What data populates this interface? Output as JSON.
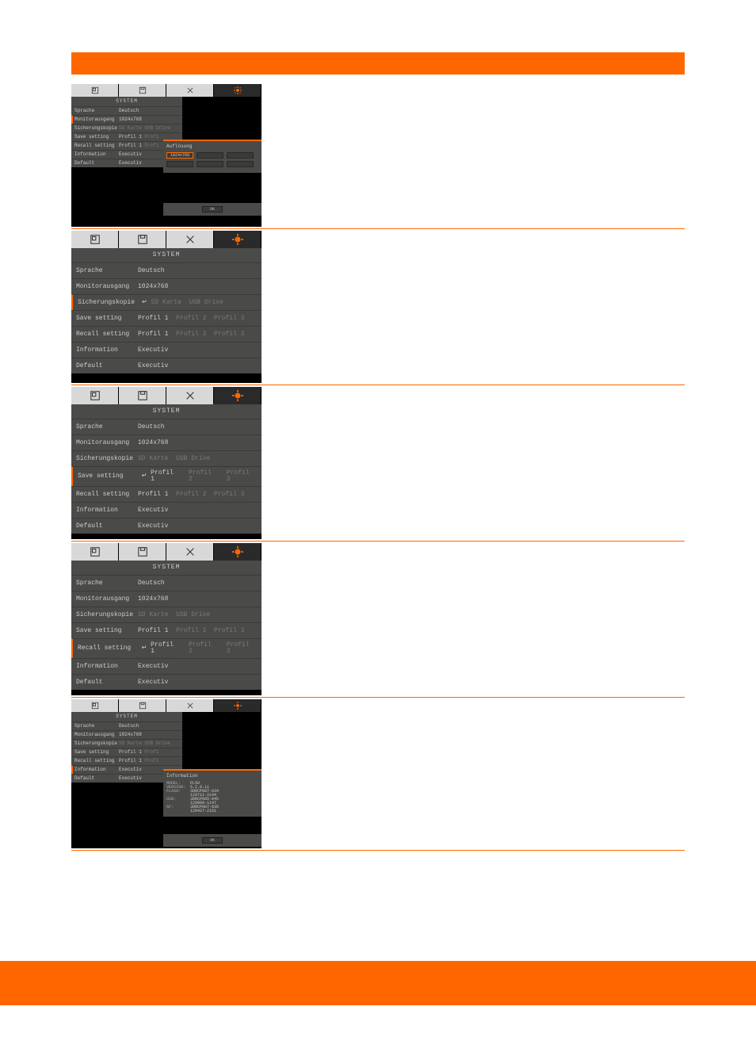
{
  "system_title": "SYSTEM",
  "menu": {
    "sprache": {
      "label": "Sprache",
      "value": "Deutsch"
    },
    "monitor": {
      "label": "Monitorausgang",
      "value": "1024x768"
    },
    "sicher": {
      "label": "Sicherungskopie",
      "sd": "SD Karte",
      "usb": "USB Drive"
    },
    "save": {
      "label": "Save setting",
      "p1": "Profil 1",
      "p2": "Profil 2",
      "p3": "Profil 3"
    },
    "recall": {
      "label": "Recall setting",
      "p1": "Profil 1",
      "p2": "Profil 2",
      "p3": "Profil 3"
    },
    "info": {
      "label": "Information",
      "value": "Executiv"
    },
    "default": {
      "label": "Default",
      "value": "Executiv"
    }
  },
  "popup_res": {
    "title": "Auflösung",
    "opts": [
      "1024x768",
      "",
      "",
      "",
      "",
      ""
    ],
    "ok": "OK"
  },
  "popup_info": {
    "title": "Information",
    "rows": [
      {
        "k": "MODEL:",
        "v": "PL50"
      },
      {
        "k": "VERSION:",
        "v": "5.2.0.11"
      },
      {
        "k": "FLASH:",
        "v": "3DRCP087-034"
      },
      {
        "k": "",
        "v": "129711-2144"
      },
      {
        "k": "USB:",
        "v": "3DRCP085-045"
      },
      {
        "k": "",
        "v": "129099-1147"
      },
      {
        "k": "AF:",
        "v": "3DRCP087-035"
      },
      {
        "k": "",
        "v": "129427-2151"
      }
    ],
    "ok": "OK"
  },
  "icons": {
    "frame": "frame-icon",
    "save": "save-icon",
    "tools": "tools-icon",
    "gear": "gear-icon"
  }
}
